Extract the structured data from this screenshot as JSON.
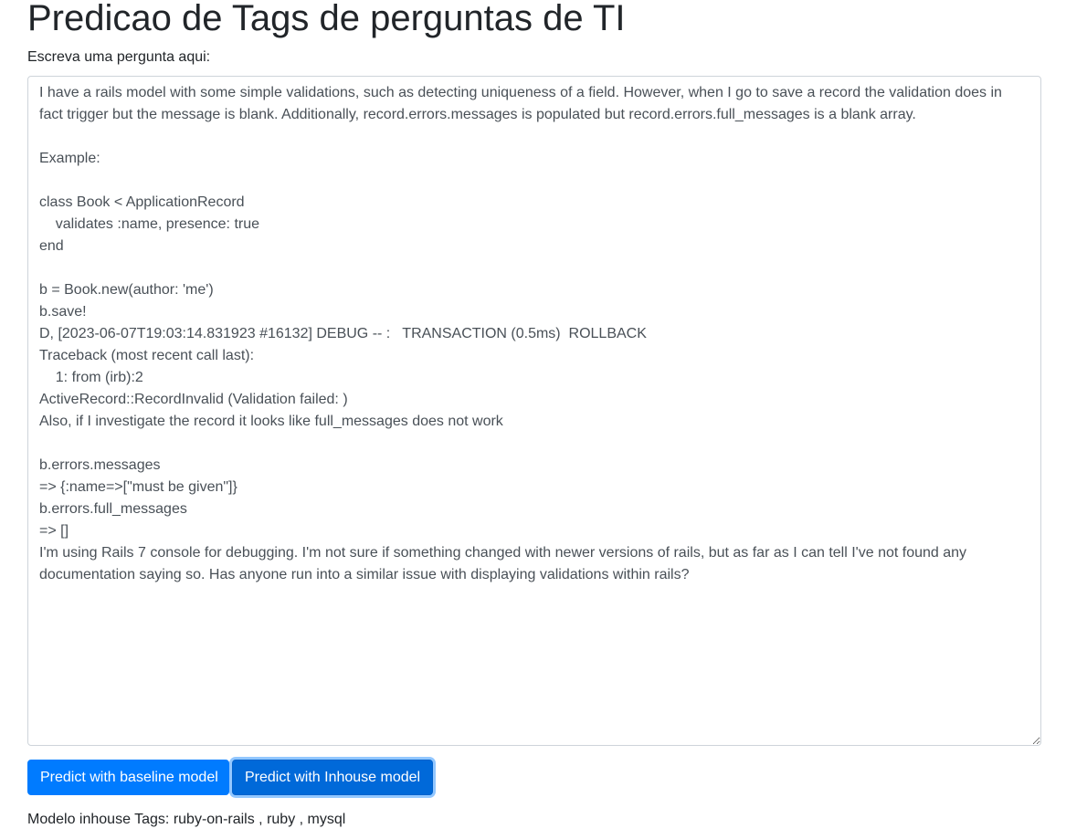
{
  "page": {
    "title": "Predicao de Tags de perguntas de TI",
    "input_label": "Escreva uma pergunta aqui:"
  },
  "question": {
    "value": "I have a rails model with some simple validations, such as detecting uniqueness of a field. However, when I go to save a record the validation does in fact trigger but the message is blank. Additionally, record.errors.messages is populated but record.errors.full_messages is a blank array.\n\nExample:\n\nclass Book < ApplicationRecord\n    validates :name, presence: true\nend\n\nb = Book.new(author: 'me')\nb.save!\nD, [2023-06-07T19:03:14.831923 #16132] DEBUG -- :   TRANSACTION (0.5ms)  ROLLBACK\nTraceback (most recent call last):\n    1: from (irb):2\nActiveRecord::RecordInvalid (Validation failed: )\nAlso, if I investigate the record it looks like full_messages does not work\n\nb.errors.messages\n=> {:name=>[\"must be given\"]}\nb.errors.full_messages\n=> []\nI'm using Rails 7 console for debugging. I'm not sure if something changed with newer versions of rails, but as far as I can tell I've not found any documentation saying so. Has anyone run into a similar issue with displaying validations within rails?"
  },
  "buttons": {
    "baseline_label": "Predict with baseline model",
    "inhouse_label": "Predict with Inhouse model"
  },
  "result": {
    "text": "Modelo inhouse Tags: ruby-on-rails , ruby , mysql"
  },
  "colors": {
    "primary": "#007bff",
    "primary_active": "#0069d9",
    "text": "#212529",
    "input_text": "#495057",
    "border": "#ced4da"
  }
}
